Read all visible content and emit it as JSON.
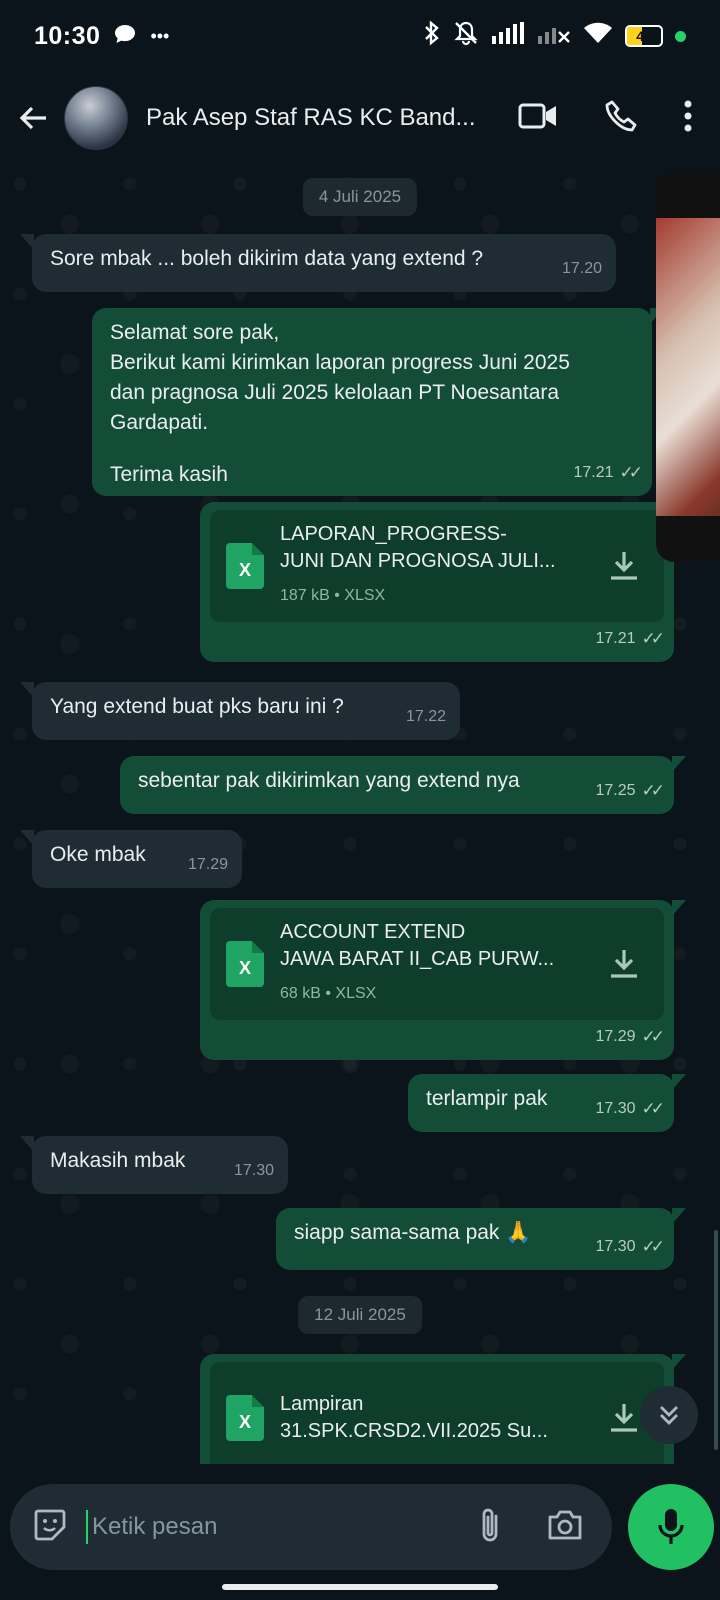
{
  "status_bar": {
    "time": "10:30",
    "more": "•••",
    "battery": "44"
  },
  "header": {
    "contact_name": "Pak Asep Staf RAS KC Band..."
  },
  "chat": {
    "date_1": "4 Juli 2025",
    "date_2": "12 Juli 2025",
    "messages": [
      {
        "text": "Sore mbak ... boleh dikirim data yang extend ?",
        "time": "17.20"
      },
      {
        "lines": [
          "Selamat sore pak,",
          "Berikut kami kirimkan laporan progress Juni 2025",
          "dan pragnosa Juli 2025 kelolaan PT Noesantara",
          "Gardapati.",
          "",
          "Terima kasih"
        ],
        "time": "17.21"
      },
      {
        "file_line1": "LAPORAN_PROGRESS-",
        "file_line2": "JUNI DAN PROGNOSA JULI...",
        "file_meta": "187 kB • XLSX",
        "time": "17.21"
      },
      {
        "text": "Yang extend buat pks baru ini ?",
        "time": "17.22"
      },
      {
        "text": "sebentar pak dikirimkan yang extend nya",
        "time": "17.25"
      },
      {
        "text": "Oke mbak",
        "time": "17.29"
      },
      {
        "file_line1": "ACCOUNT EXTEND",
        "file_line2": "JAWA BARAT II_CAB PURW...",
        "file_meta": "68 kB • XLSX",
        "time": "17.29"
      },
      {
        "text": "terlampir pak",
        "time": "17.30"
      },
      {
        "text": "Makasih mbak",
        "time": "17.30"
      },
      {
        "text": "siapp sama-sama pak 🙏",
        "time": "17.30"
      },
      {
        "file_line1": "Lampiran",
        "file_line2": "31.SPK.CRSD2.VII.2025 Su..."
      }
    ]
  },
  "input": {
    "placeholder": "Ketik pesan"
  },
  "icons": {
    "file_type_letter": "X"
  },
  "colors": {
    "accent": "#25d366",
    "outgoing": "#144d37",
    "incoming": "#202c33",
    "background": "#0b141a"
  }
}
